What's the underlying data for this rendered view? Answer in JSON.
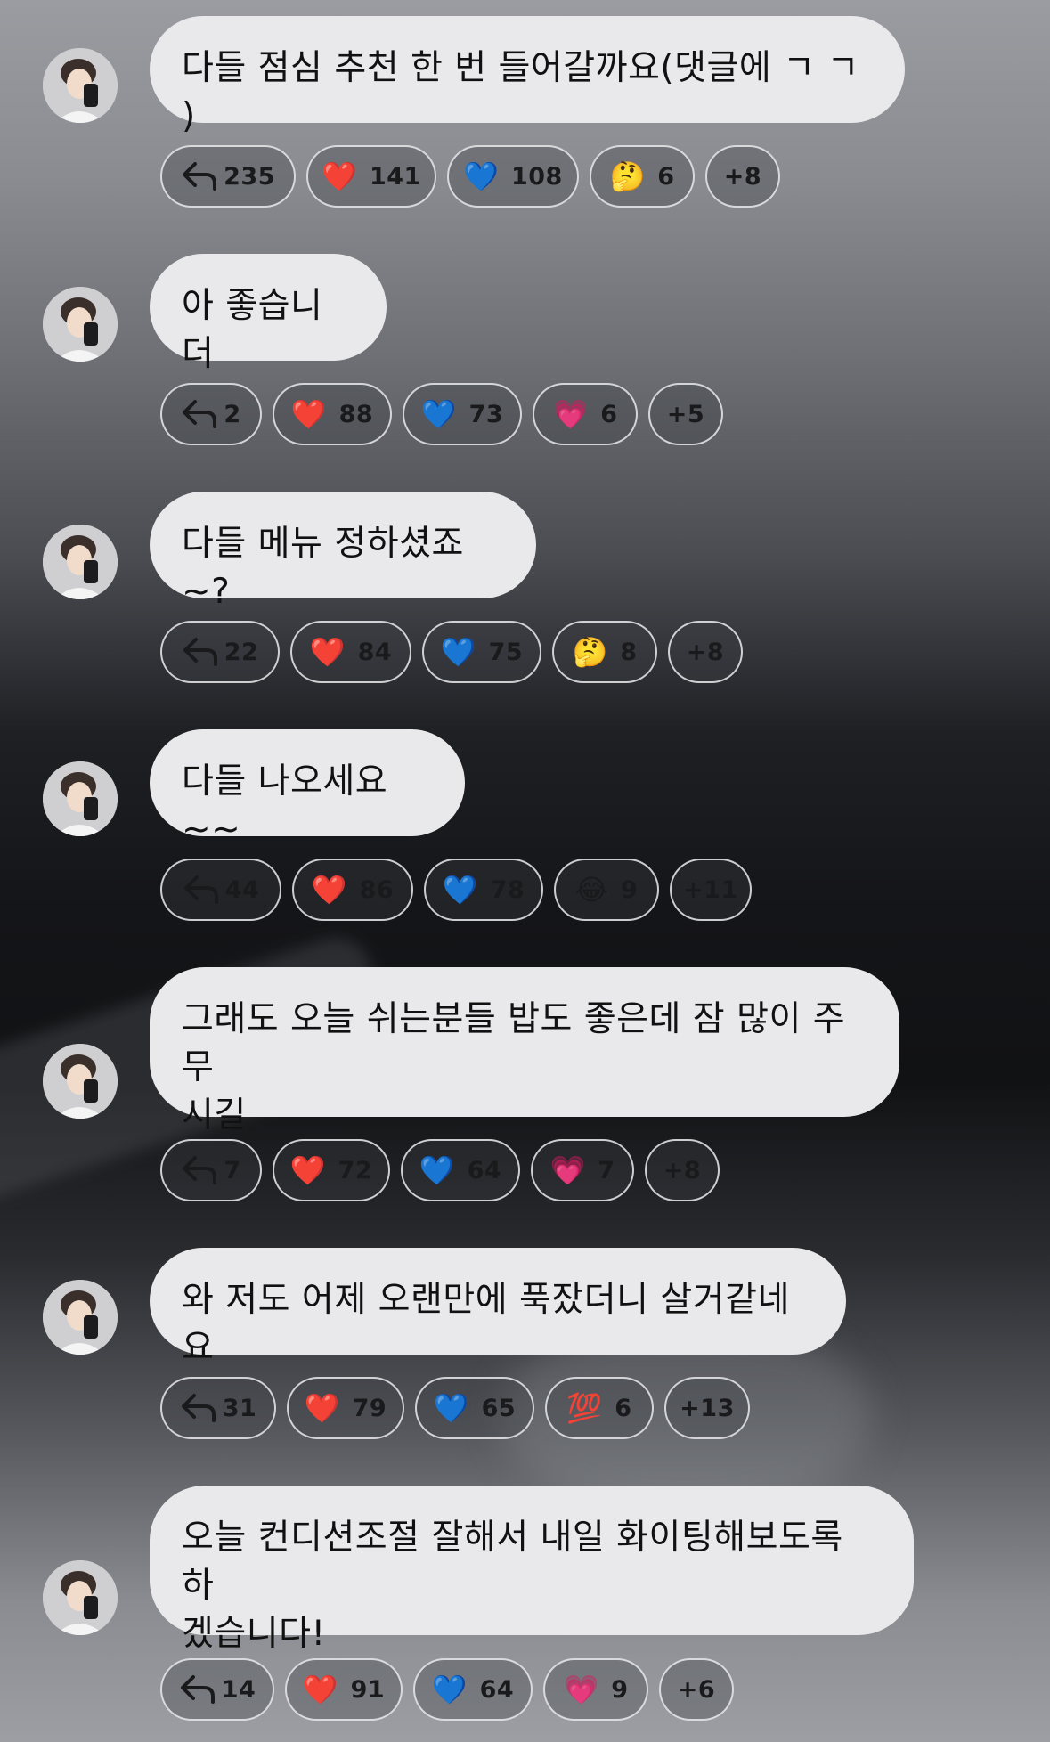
{
  "messages": [
    {
      "text": "다들 점심 추천 한 번 들어갈까요(댓글에 ㄱ ㄱ )",
      "replies": "235",
      "reactions": [
        {
          "emoji": "❤️",
          "count": "141"
        },
        {
          "emoji": "💙",
          "count": "108"
        },
        {
          "emoji": "🤔",
          "count": "6"
        }
      ],
      "more": "+8"
    },
    {
      "text": "아 좋습니더",
      "replies": "2",
      "reactions": [
        {
          "emoji": "❤️",
          "count": "88"
        },
        {
          "emoji": "💙",
          "count": "73"
        },
        {
          "emoji": "💗",
          "count": "6"
        }
      ],
      "more": "+5"
    },
    {
      "text": "다들 메뉴 정하셨죠~?",
      "replies": "22",
      "reactions": [
        {
          "emoji": "❤️",
          "count": "84"
        },
        {
          "emoji": "💙",
          "count": "75"
        },
        {
          "emoji": "🤔",
          "count": "8"
        }
      ],
      "more": "+8"
    },
    {
      "text": "다들 나오세요~~",
      "replies": "44",
      "reactions": [
        {
          "emoji": "❤️",
          "count": "86"
        },
        {
          "emoji": "💙",
          "count": "78"
        },
        {
          "emoji": "😂",
          "count": "9"
        }
      ],
      "more": "+11"
    },
    {
      "text_lines": [
        "그래도 오늘 쉬는분들 밥도 좋은데 잠 많이 주무",
        "시길"
      ],
      "replies": "7",
      "reactions": [
        {
          "emoji": "❤️",
          "count": "72"
        },
        {
          "emoji": "💙",
          "count": "64"
        },
        {
          "emoji": "💗",
          "count": "7"
        }
      ],
      "more": "+8"
    },
    {
      "text": "와 저도 어제 오랜만에 푹잤더니 살거같네요",
      "replies": "31",
      "reactions": [
        {
          "emoji": "❤️",
          "count": "79"
        },
        {
          "emoji": "💙",
          "count": "65"
        },
        {
          "emoji": "💯",
          "count": "6"
        }
      ],
      "more": "+13"
    },
    {
      "text_lines": [
        "오늘 컨디션조절 잘해서 내일 화이팅해보도록 하",
        "겠습니다!"
      ],
      "replies": "14",
      "reactions": [
        {
          "emoji": "❤️",
          "count": "91"
        },
        {
          "emoji": "💙",
          "count": "64"
        },
        {
          "emoji": "💗",
          "count": "9"
        }
      ],
      "more": "+6"
    }
  ]
}
